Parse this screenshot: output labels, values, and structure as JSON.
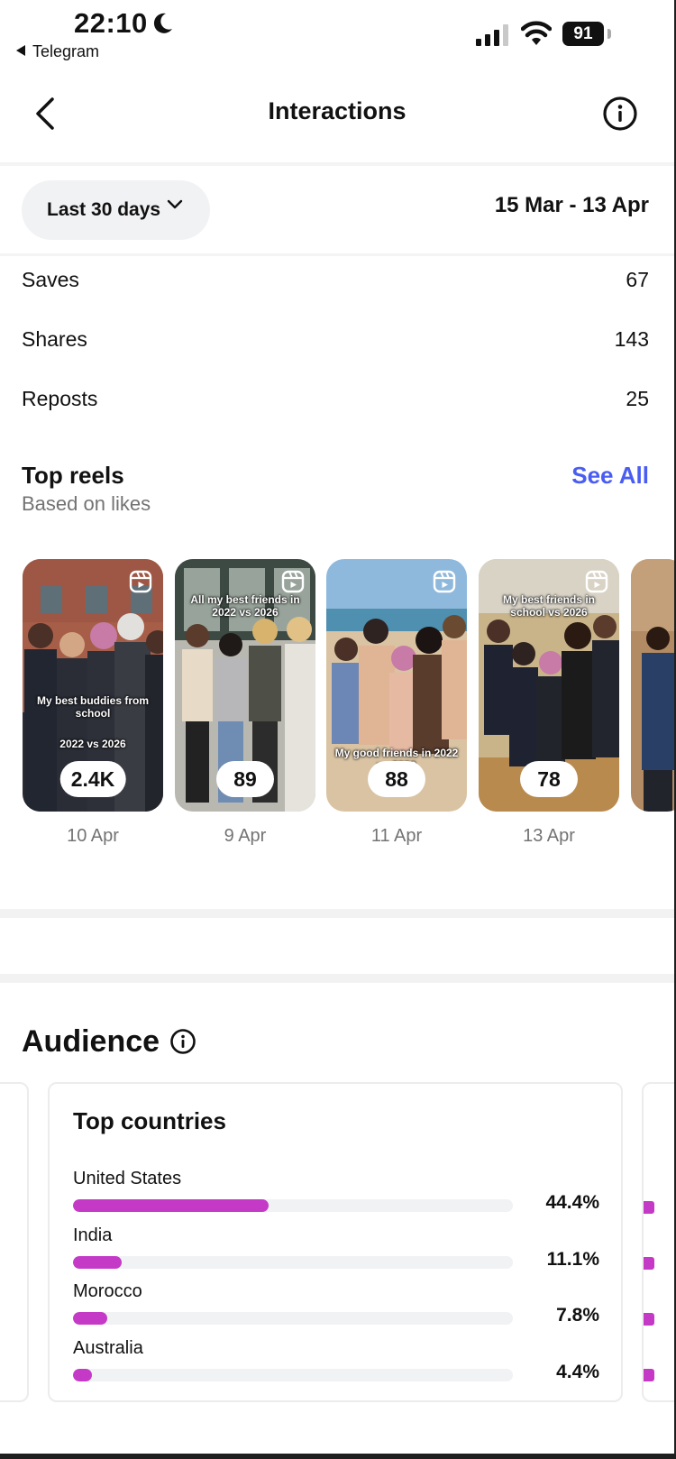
{
  "status": {
    "time": "22:10",
    "back_app": "Telegram",
    "battery": "91"
  },
  "nav": {
    "title": "Interactions"
  },
  "filter": {
    "range_label": "Last 30 days",
    "date_range": "15 Mar - 13 Apr"
  },
  "metrics": [
    {
      "label": "Saves",
      "value": "67"
    },
    {
      "label": "Shares",
      "value": "143"
    },
    {
      "label": "Reposts",
      "value": "25"
    }
  ],
  "top_reels": {
    "title": "Top reels",
    "subtitle": "Based on likes",
    "see_all": "See All",
    "items": [
      {
        "caption_top": "",
        "caption_mid": "My best buddies from school",
        "caption_bottom": "2022 vs 2026",
        "likes": "2.4K",
        "date": "10 Apr"
      },
      {
        "caption_top": "All my best friends in 2022 vs 2026",
        "caption_mid": "",
        "caption_bottom": "",
        "likes": "89",
        "date": "9 Apr"
      },
      {
        "caption_top": "",
        "caption_mid": "",
        "caption_bottom": "My good friends in 2022 vs 2026",
        "likes": "88",
        "date": "11 Apr"
      },
      {
        "caption_top": "My best friends in school vs 2026",
        "caption_mid": "",
        "caption_bottom": "",
        "likes": "78",
        "date": "13 Apr"
      }
    ]
  },
  "audience": {
    "title": "Audience",
    "card_title": "Top countries",
    "countries": [
      {
        "name": "United States",
        "percent_label": "44.4%",
        "percent": 44.4
      },
      {
        "name": "India",
        "percent_label": "11.1%",
        "percent": 11.1
      },
      {
        "name": "Morocco",
        "percent_label": "7.8%",
        "percent": 7.8
      },
      {
        "name": "Australia",
        "percent_label": "4.4%",
        "percent": 4.4
      }
    ]
  },
  "colors": {
    "accent_link": "#4a5df2",
    "bar": "#c43ac7",
    "muted_text": "#737373"
  },
  "icons": [
    "moon-icon",
    "signal-icon",
    "wifi-icon",
    "battery-icon",
    "back-chevron-icon",
    "info-icon",
    "chevron-down-icon",
    "reel-icon"
  ]
}
